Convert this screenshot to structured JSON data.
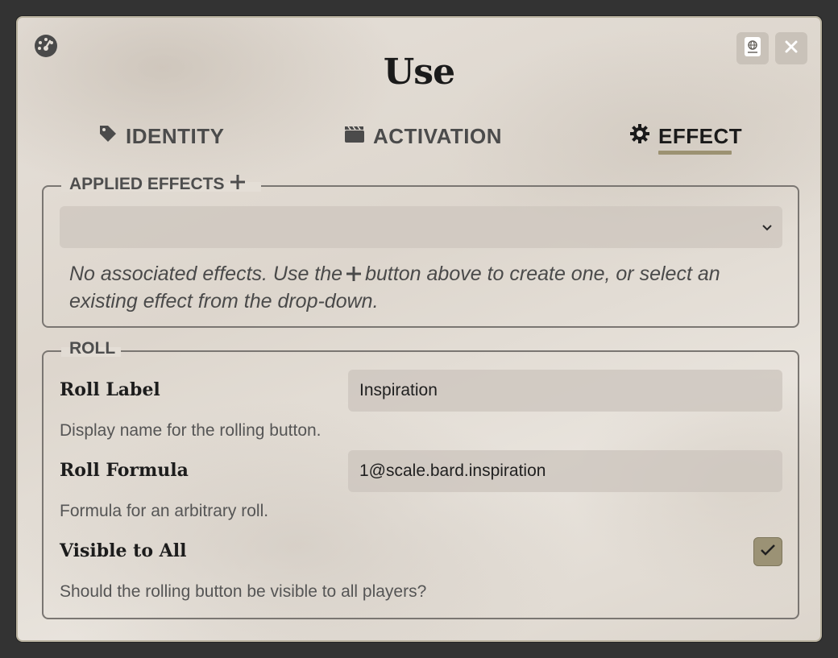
{
  "dialog": {
    "title": "Use",
    "icons": {
      "corner": "dashboard-icon",
      "sheet": "globe-sheet-icon",
      "close": "close-icon"
    }
  },
  "tabs": [
    {
      "label": "IDENTITY",
      "icon": "tag-icon",
      "active": false
    },
    {
      "label": "ACTIVATION",
      "icon": "clapperboard-icon",
      "active": false
    },
    {
      "label": "EFFECT",
      "icon": "gear-icon",
      "active": true
    }
  ],
  "applied_effects": {
    "legend": "APPLIED EFFECTS",
    "select_value": "",
    "hint_before": "No associated effects. Use the",
    "hint_after": "button above to create one, or select an existing effect from the drop-down."
  },
  "roll": {
    "legend": "ROLL",
    "fields": [
      {
        "label": "Roll Label",
        "value": "Inspiration",
        "hint": "Display name for the rolling button."
      },
      {
        "label": "Roll Formula",
        "value": "1@scale.bard.inspiration",
        "hint": "Formula for an arbitrary roll."
      }
    ],
    "visible": {
      "label": "Visible to All",
      "checked": true,
      "hint": "Should the rolling button be visible to all players?"
    }
  },
  "colors": {
    "accent": "#9b9275",
    "backdrop": "#333333"
  }
}
